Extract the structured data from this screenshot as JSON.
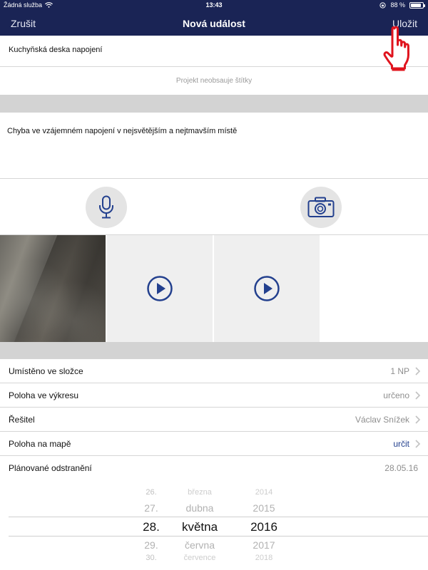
{
  "status_bar": {
    "carrier": "Žádná služba",
    "time": "13:43",
    "battery": "88 %",
    "battery_level": 0.88
  },
  "nav": {
    "cancel_label": "Zrušit",
    "title": "Nová událost",
    "save_label": "Uložit"
  },
  "event": {
    "name": "Kuchyňská deska napojení",
    "tags_placeholder": "Projekt neobsauje štítky",
    "description": "Chyba ve vzájemném napojení v nejsvětějším a nejtmavším místě"
  },
  "media": {
    "mic_icon": "microphone-icon",
    "camera_icon": "camera-icon",
    "thumbnails": [
      "photo",
      "video",
      "video",
      "empty"
    ]
  },
  "details": [
    {
      "label": "Umístěno ve složce",
      "value": "1 NP",
      "style": "muted",
      "chevron": true
    },
    {
      "label": "Poloha ve výkresu",
      "value": "určeno",
      "style": "muted",
      "chevron": true
    },
    {
      "label": "Řešitel",
      "value": "Václav Snížek",
      "style": "muted",
      "chevron": true
    },
    {
      "label": "Poloha na mapě",
      "value": "určit",
      "style": "link",
      "chevron": true
    },
    {
      "label": "Plánované odstranění",
      "value": "28.05.16",
      "style": "muted",
      "chevron": false
    }
  ],
  "date_picker": {
    "days": [
      "26.",
      "27.",
      "28.",
      "29.",
      "30."
    ],
    "months": [
      "března",
      "dubna",
      "května",
      "června",
      "července"
    ],
    "years": [
      "2014",
      "2015",
      "2016",
      "2017",
      "2018"
    ],
    "selected_index": 2
  },
  "colors": {
    "nav_bg": "#1a2455",
    "accent": "#23408e",
    "separator": "#d3d3d3",
    "pointer_hand": "#e0141e"
  }
}
